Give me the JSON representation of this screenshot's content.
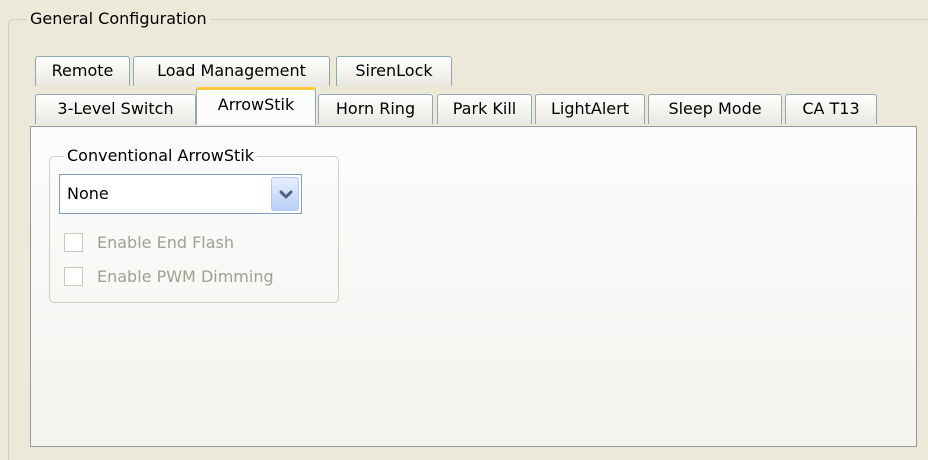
{
  "group": {
    "title": "General Configuration"
  },
  "tabs": {
    "row1": [
      {
        "label": "Remote"
      },
      {
        "label": "Load Management"
      },
      {
        "label": "SirenLock"
      }
    ],
    "row2": [
      {
        "label": "3-Level Switch"
      },
      {
        "label": "ArrowStik",
        "active": true
      },
      {
        "label": "Horn Ring"
      },
      {
        "label": "Park Kill"
      },
      {
        "label": "LightAlert"
      },
      {
        "label": "Sleep Mode"
      },
      {
        "label": "CA T13"
      }
    ]
  },
  "arrowstik": {
    "group_title": "Conventional ArrowStik",
    "select": {
      "value": "None",
      "icon": "chevron-down-icon"
    },
    "checkboxes": [
      {
        "label": "Enable End Flash",
        "checked": false,
        "enabled": false
      },
      {
        "label": "Enable PWM Dimming",
        "checked": false,
        "enabled": false
      }
    ]
  },
  "colors": {
    "window_bg": "#ece9d8",
    "active_tab_highlight": "#ffc83c",
    "tab_border": "#91a7b4",
    "disabled_text": "#a1a192",
    "combo_border": "#7f9db9"
  }
}
